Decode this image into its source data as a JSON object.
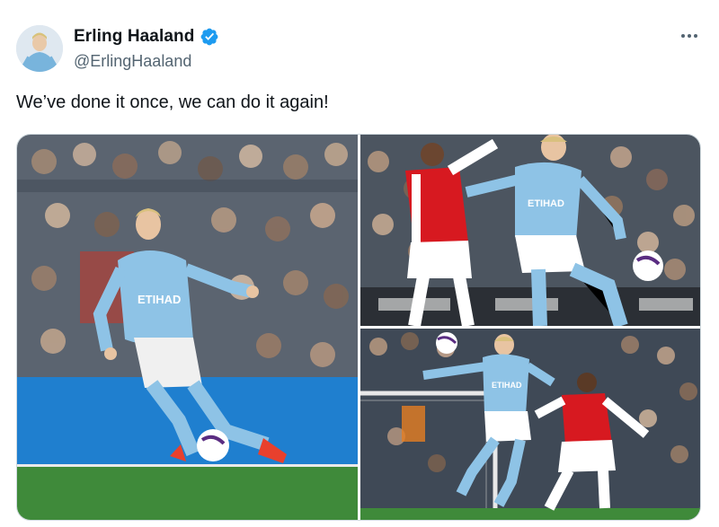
{
  "tweet": {
    "author": {
      "display_name": "Erling Haaland",
      "handle": "@ErlingHaaland",
      "verified": true,
      "avatar_icon": "avatar-photo"
    },
    "more_icon": "more-options-icon",
    "text": "We’ve done it once, we can do it again!",
    "media": [
      {
        "icon": "photo-haaland-dribbling",
        "jersey_text": "ETIHAD"
      },
      {
        "icon": "photo-haaland-shielding-ball",
        "jersey_text": "ETIHAD"
      },
      {
        "icon": "photo-haaland-challenge",
        "jersey_text": "ETIHAD"
      }
    ],
    "colors": {
      "verified_blue": "#1d9bf0",
      "text": "#0f1419",
      "secondary_text": "#536471",
      "city_blue": "#8ec3e6",
      "arsenal_red": "#d71920"
    }
  }
}
